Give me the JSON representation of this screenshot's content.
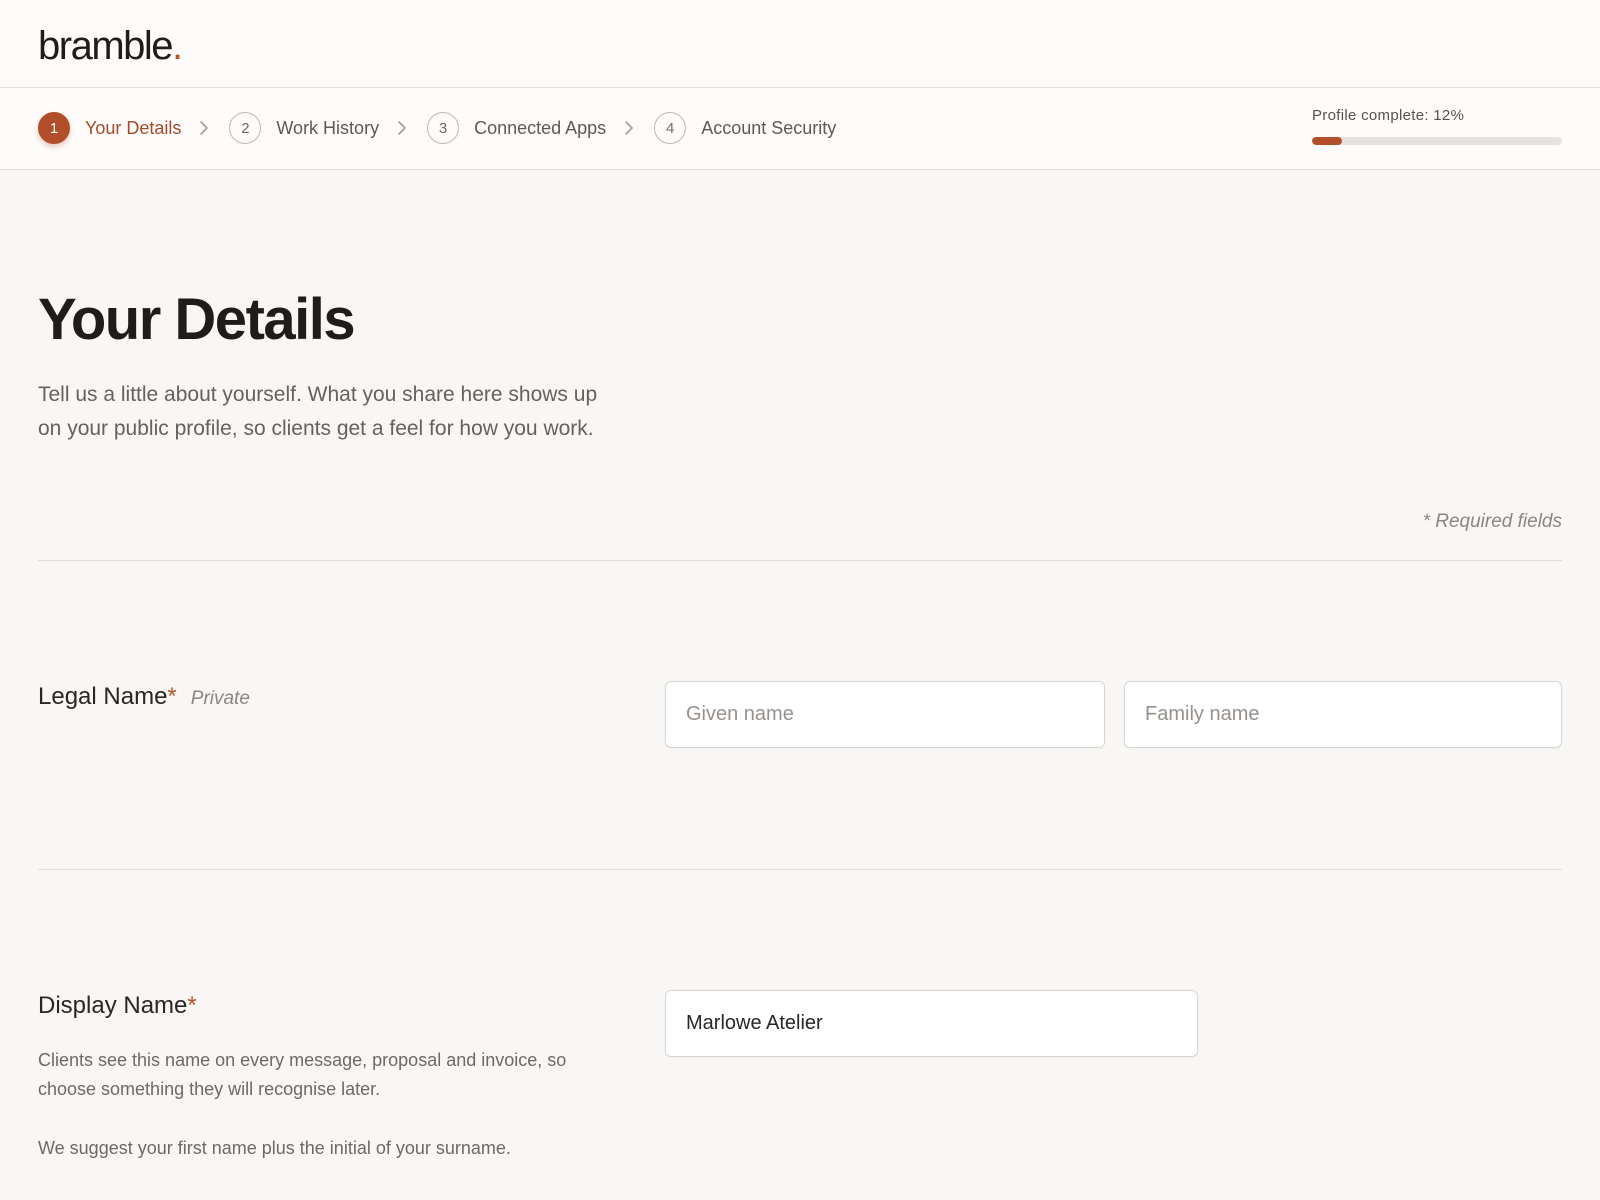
{
  "brand": {
    "name": "bramble",
    "dot": ".",
    "accent_color": "#b24e2a"
  },
  "steps": [
    {
      "number": "1",
      "label": "Your Details",
      "active": true
    },
    {
      "number": "2",
      "label": "Work History",
      "active": false
    },
    {
      "number": "3",
      "label": "Connected Apps",
      "active": false
    },
    {
      "number": "4",
      "label": "Account Security",
      "active": false
    }
  ],
  "progress": {
    "label": "Profile complete: 12%",
    "percent": 12
  },
  "page": {
    "title": "Your Details",
    "intro": "Tell us a little about yourself. What you share here shows up on your public profile, so clients get a feel for how you work.",
    "required_note": "* Required fields"
  },
  "legal_name": {
    "label": "Legal Name",
    "required_mark": "*",
    "private_tag": "Private",
    "given_placeholder": "Given name",
    "given_value": "",
    "family_placeholder": "Family name",
    "family_value": ""
  },
  "display_name": {
    "label": "Display Name",
    "required_mark": "*",
    "value": "Marlowe Atelier",
    "help_1": "Clients see this name on every message, proposal and invoice, so choose something they will recognise later.",
    "help_2": "We suggest your first name plus the initial of your surname."
  }
}
